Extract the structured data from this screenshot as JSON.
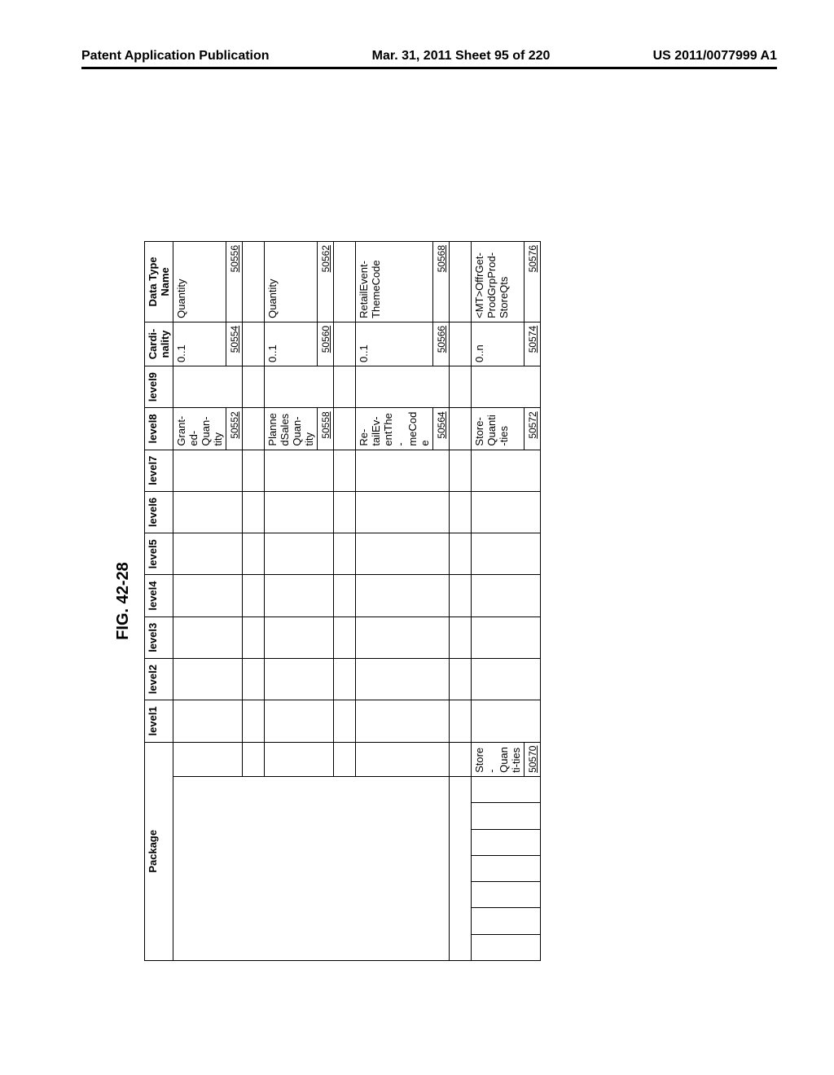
{
  "header": {
    "left": "Patent Application Publication",
    "mid": "Mar. 31, 2011  Sheet 95 of 220",
    "right": "US 2011/0077999 A1"
  },
  "figure_label": "FIG. 42-28",
  "columns": {
    "package": "Package",
    "l1": "level1",
    "l2": "level2",
    "l3": "level3",
    "l4": "level4",
    "l5": "level5",
    "l6": "level6",
    "l7": "level7",
    "l8": "level8",
    "l9": "level9",
    "card": "Cardi-nality",
    "dtype": "Data Type Name"
  },
  "rows": [
    {
      "pkg_sub": "",
      "l8": "Grant-ed-Quan-tity",
      "l8_ref": "50552",
      "card": "0..1",
      "card_ref": "50554",
      "dtype": "Quantity",
      "dtype_ref": "50556"
    },
    {
      "pkg_sub": "",
      "l8": "PlannedSalesQuan-tity",
      "l8_ref": "50558",
      "card": "0..1",
      "card_ref": "50560",
      "dtype": "Quantity",
      "dtype_ref": "50562"
    },
    {
      "pkg_sub": "",
      "l8": "Re-tailEv-entThe-meCode",
      "l8_ref": "50564",
      "card": "0..1",
      "card_ref": "50566",
      "dtype": "RetailEvent-ThemeCode",
      "dtype_ref": "50568"
    },
    {
      "pkg_sub": "Store-Quanti-ties",
      "pkg_sub_ref": "50570",
      "l8": "Store-Quanti-ties",
      "l8_ref": "50572",
      "card": "0..n",
      "card_ref": "50574",
      "dtype": "<MT>OffrGet-ProdGrpProd-StoreQts",
      "dtype_ref": "50576"
    }
  ]
}
